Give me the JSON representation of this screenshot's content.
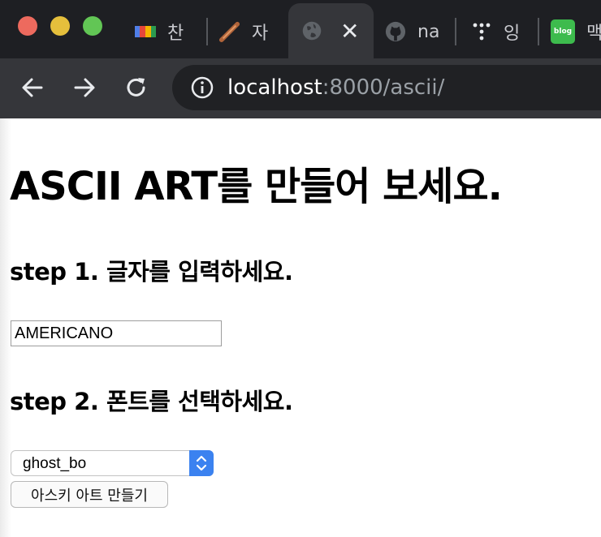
{
  "browser": {
    "tabs": [
      {
        "label": "찬",
        "icon": "rainbow-favicon"
      },
      {
        "label": "자",
        "icon": "sword-favicon"
      },
      {
        "label": "",
        "icon": "globe-favicon",
        "active": true
      },
      {
        "label": "na",
        "icon": "github-favicon"
      },
      {
        "label": "잉",
        "icon": "dots-favicon"
      },
      {
        "label": "맥",
        "icon": "blog-favicon"
      }
    ],
    "blog_icon_text": "blog",
    "url_host": "localhost",
    "url_path": ":8000/ascii/"
  },
  "page": {
    "title": "ASCII ART를 만들어 보세요.",
    "step1_heading": "step 1. 글자를 입력하세요.",
    "text_value": "AMERICANO",
    "step2_heading": "step 2. 폰트를 선택하세요.",
    "font_selected": "ghost_bo",
    "submit_label": "아스키 아트 만들기"
  },
  "colors": {
    "tabbar_bg": "#1e1f23",
    "toolbar_bg": "#35363a",
    "omnibox_bg": "#202124",
    "select_stepper": "#3b82f0"
  }
}
